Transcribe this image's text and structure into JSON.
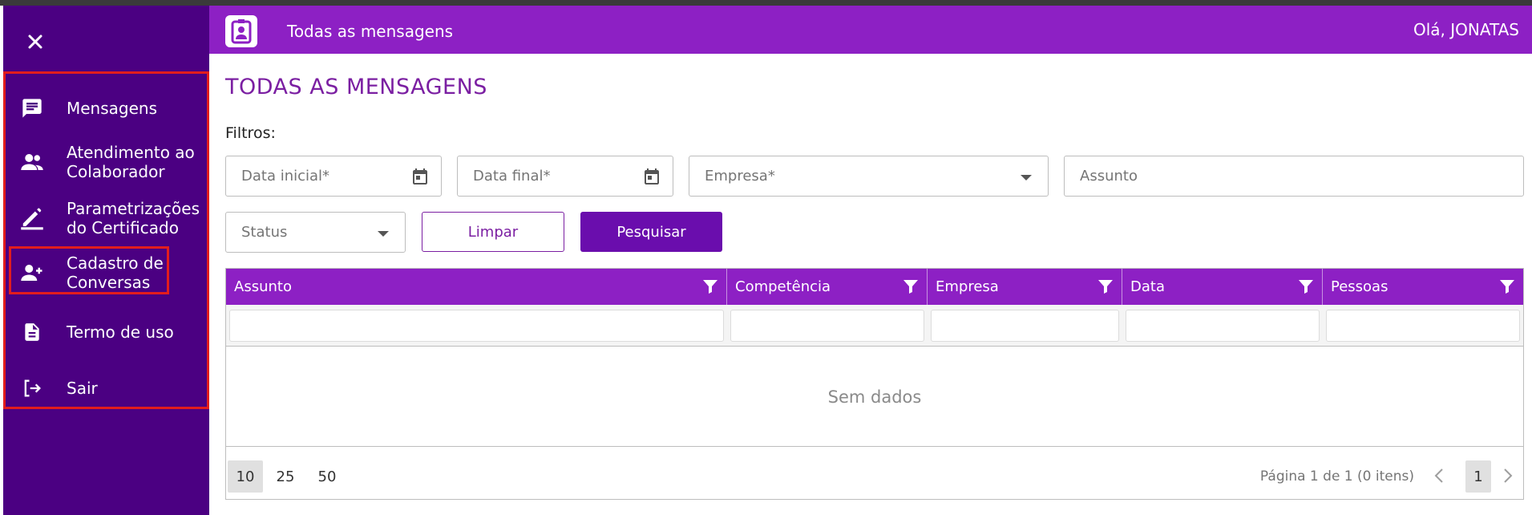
{
  "sidebar": {
    "close_icon": "close-icon",
    "items": [
      {
        "label": "Mensagens",
        "icon": "message-icon"
      },
      {
        "label": "Atendimento ao\nColaborador",
        "icon": "support-user-icon"
      },
      {
        "label": "Parametrizações\ndo Certificado",
        "icon": "edit-pencil-icon"
      },
      {
        "label": "Cadastro de\nConversas",
        "icon": "add-user-icon"
      },
      {
        "label": "Termo de uso",
        "icon": "document-icon"
      },
      {
        "label": "Sair",
        "icon": "logout-icon"
      }
    ]
  },
  "header": {
    "title": "Todas as mensagens",
    "greeting": "Olá, JONATAS"
  },
  "main": {
    "page_title": "TODAS AS MENSAGENS",
    "filters_label": "Filtros:",
    "fields": {
      "start_date": "Data inicial*",
      "end_date": "Data final*",
      "company": "Empresa*",
      "subject": "Assunto",
      "status": "Status"
    },
    "buttons": {
      "clear": "Limpar",
      "search": "Pesquisar"
    }
  },
  "grid": {
    "columns": [
      "Assunto",
      "Competência",
      "Empresa",
      "Data",
      "Pessoas"
    ],
    "empty_text": "Sem dados",
    "page_sizes": [
      "10",
      "25",
      "50"
    ],
    "selected_page_size": "10",
    "page_info": "Página 1 de 1 (0 itens)",
    "current_page": "1"
  },
  "colors": {
    "sidebar": "#4b0082",
    "header": "#8d20c4",
    "accent": "#6a0dad",
    "highlight": "#e21d1d"
  }
}
